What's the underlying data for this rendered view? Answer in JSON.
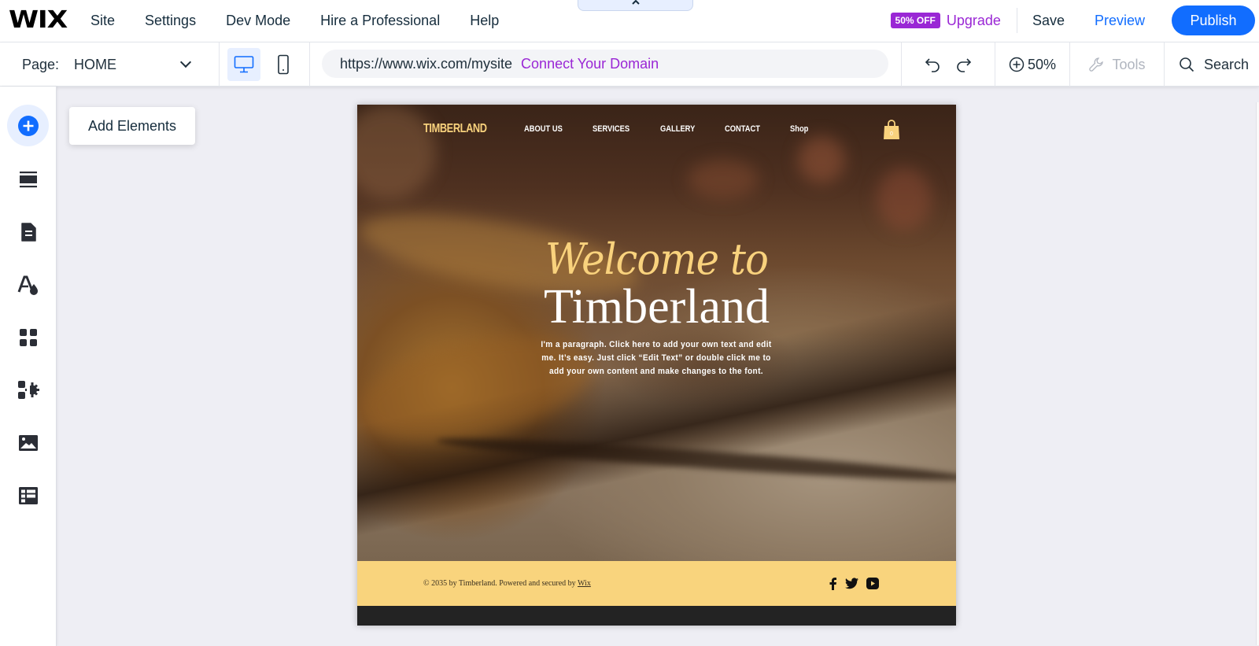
{
  "topbar": {
    "logo": "WIX",
    "menu": [
      "Site",
      "Settings",
      "Dev Mode",
      "Hire a Professional",
      "Help"
    ],
    "collapse_icon": "chevron-up-icon",
    "badge": "50% OFF",
    "upgrade": "Upgrade",
    "save": "Save",
    "preview": "Preview",
    "publish": "Publish",
    "colors": {
      "accent": "#116dff",
      "upgrade": "#9a27d5"
    }
  },
  "toolbar": {
    "page_label": "Page:",
    "page_value": "HOME",
    "devices": [
      {
        "name": "desktop",
        "active": true
      },
      {
        "name": "mobile",
        "active": false
      }
    ],
    "url": "https://www.wix.com/mysite",
    "connect_domain": "Connect Your Domain",
    "zoom": "50%",
    "tools": "Tools",
    "search": "Search"
  },
  "sidebar": {
    "items": [
      {
        "icon": "add-icon",
        "label": "Add Elements",
        "active": true
      },
      {
        "icon": "sections-icon"
      },
      {
        "icon": "pages-icon"
      },
      {
        "icon": "design-icon"
      },
      {
        "icon": "apps-icon"
      },
      {
        "icon": "business-apps-icon"
      },
      {
        "icon": "media-icon"
      },
      {
        "icon": "cms-icon"
      }
    ],
    "tooltip": "Add Elements"
  },
  "site": {
    "logo": "TIMBERLAND",
    "nav": [
      "ABOUT US",
      "SERVICES",
      "GALLERY",
      "CONTACT",
      "Shop"
    ],
    "cart_count": "0",
    "welcome": "Welcome to",
    "title": "Timberland",
    "paragraph": "I'm a paragraph. Click here to add your own text and edit me. It’s easy. Just click “Edit Text” or double click me to add your own content and make changes to the font.",
    "footer_text": "© 2035 by Timberland. Powered and secured by ",
    "footer_link": "Wix",
    "social": [
      "facebook",
      "twitter",
      "youtube"
    ],
    "colors": {
      "gold": "#f9d27d",
      "footer_bg": "#f9d47d",
      "strip": "#232323"
    }
  }
}
